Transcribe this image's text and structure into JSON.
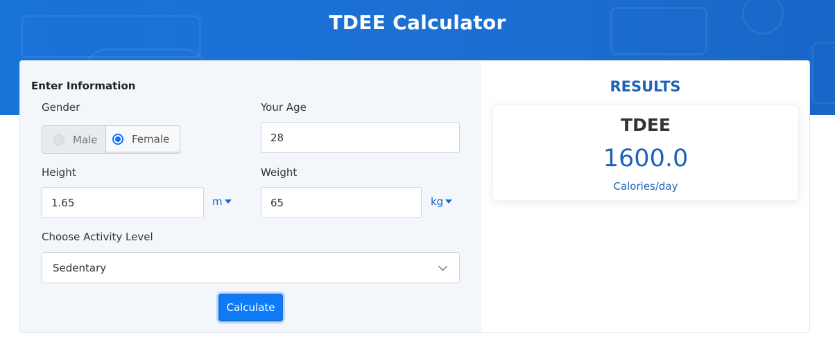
{
  "header": {
    "title": "TDEE Calculator"
  },
  "form": {
    "section_title": "Enter Information",
    "gender": {
      "label": "Gender",
      "options": [
        "Male",
        "Female"
      ],
      "selected": "Female"
    },
    "age": {
      "label": "Your Age",
      "value": "28"
    },
    "height": {
      "label": "Height",
      "value": "1.65",
      "unit": "m"
    },
    "weight": {
      "label": "Weight",
      "value": "65",
      "unit": "kg"
    },
    "activity": {
      "label": "Choose Activity Level",
      "selected": "Sedentary"
    },
    "calculate_label": "Calculate"
  },
  "results": {
    "title": "RESULTS",
    "metric": "TDEE",
    "value": "1600.0",
    "unit": "Calories/day"
  },
  "colors": {
    "brand": "#1a73d9",
    "accent": "#1c63b7",
    "button": "#0d7bf5",
    "radio_selected": "#0d6efd"
  },
  "icons": {
    "unit_caret": "caret-down-icon",
    "select_chevron": "chevron-down-icon"
  }
}
